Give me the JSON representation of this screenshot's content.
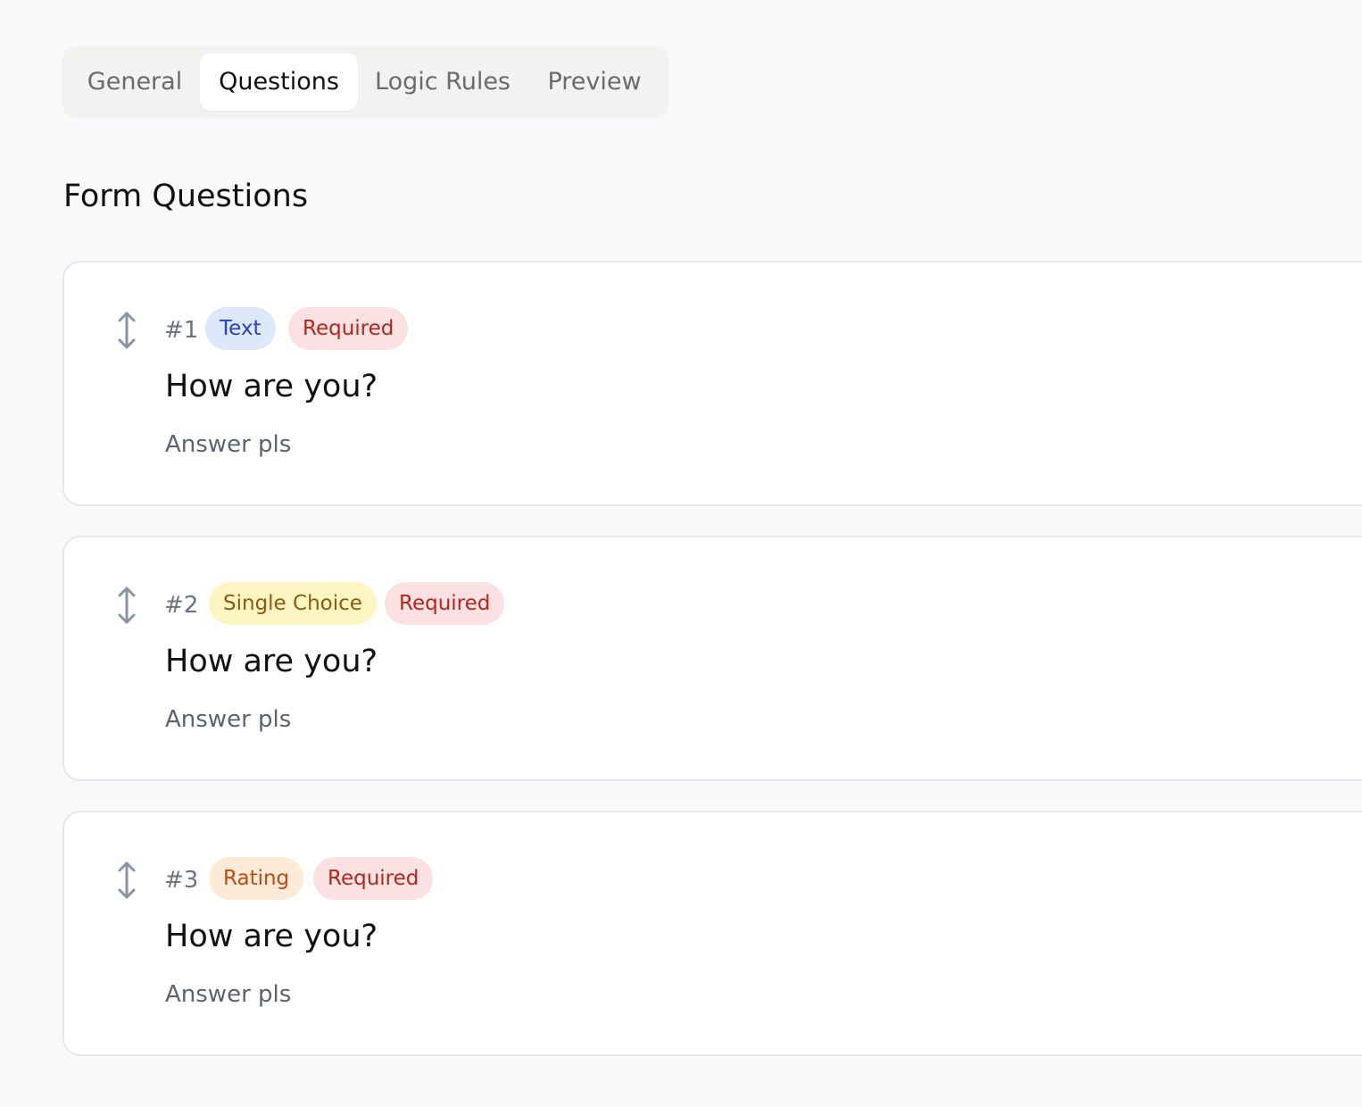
{
  "tabs": [
    {
      "label": "General",
      "active": false
    },
    {
      "label": "Questions",
      "active": true
    },
    {
      "label": "Logic Rules",
      "active": false
    },
    {
      "label": "Preview",
      "active": false
    }
  ],
  "section_title": "Form Questions",
  "colors": {
    "page_background": "#f8f9fb",
    "text_badge_bg": "#dde8fb",
    "text_badge_fg": "#2443c4",
    "single_choice_badge_bg": "#fdf6c3",
    "single_choice_badge_fg": "#8a5a12",
    "rating_badge_bg": "#fdebd7",
    "rating_badge_fg": "#bf4a12",
    "required_badge_bg": "#fbe1e1",
    "required_badge_fg": "#b3261e"
  },
  "questions": [
    {
      "number": "#1",
      "type": "Text",
      "required_label": "Required",
      "title": "How are you?",
      "description": "Answer pls",
      "drag_icon": "drag-vertical-arrows-icon"
    },
    {
      "number": "#2",
      "type": "Single Choice",
      "required_label": "Required",
      "title": "How are you?",
      "description": "Answer pls",
      "drag_icon": "drag-vertical-arrows-icon"
    },
    {
      "number": "#3",
      "type": "Rating",
      "required_label": "Required",
      "title": "How are you?",
      "description": "Answer pls",
      "drag_icon": "drag-vertical-arrows-icon"
    }
  ]
}
